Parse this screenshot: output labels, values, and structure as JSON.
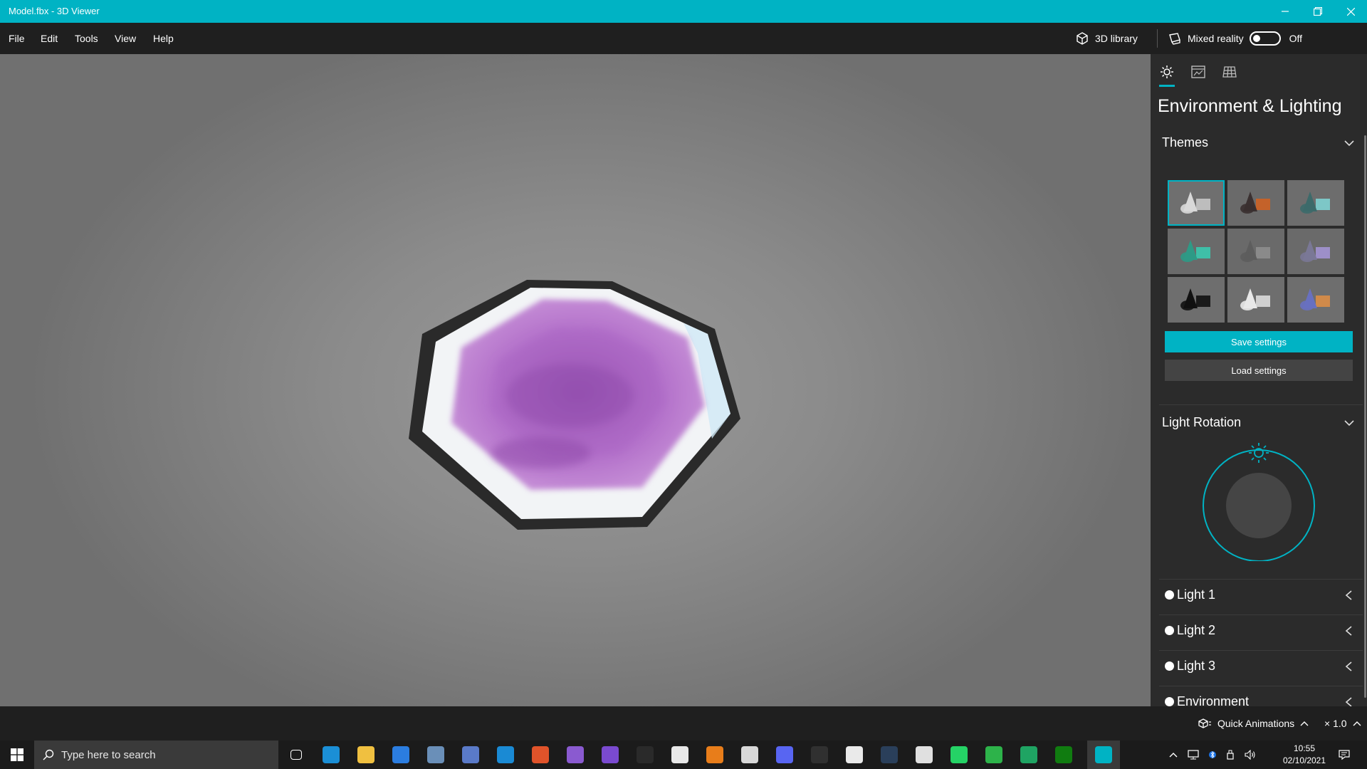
{
  "window": {
    "title": "Model.fbx - 3D Viewer"
  },
  "menu": {
    "items": [
      "File",
      "Edit",
      "Tools",
      "View",
      "Help"
    ],
    "library_label": "3D library",
    "mixed_reality_label": "Mixed reality",
    "mixed_reality_state": "Off"
  },
  "panel": {
    "title": "Environment & Lighting",
    "tabs": [
      "sun-icon",
      "stats-icon",
      "grid-icon"
    ],
    "themes": {
      "title": "Themes",
      "tiles": [
        {
          "name": "theme-1",
          "bg": "#6f6f6f",
          "shape": "#d8d8d8",
          "accent": "#bdbdbd"
        },
        {
          "name": "theme-2",
          "bg": "#6a6a6a",
          "shape": "#3a3030",
          "accent": "#c4622a"
        },
        {
          "name": "theme-3",
          "bg": "#6d6d6d",
          "shape": "#3c6a6a",
          "accent": "#7dc7c7"
        },
        {
          "name": "theme-4",
          "bg": "#6a6a6a",
          "shape": "#2e9a86",
          "accent": "#3fbfa8"
        },
        {
          "name": "theme-5",
          "bg": "#6a6a6a",
          "shape": "#5d5d5d",
          "accent": "#8a8a8a"
        },
        {
          "name": "theme-6",
          "bg": "#6a6a6a",
          "shape": "#7a7896",
          "accent": "#9d8fc8"
        },
        {
          "name": "theme-7",
          "bg": "#6e6e6e",
          "shape": "#111111",
          "accent": "#1a1a1a"
        },
        {
          "name": "theme-8",
          "bg": "#6e6e6e",
          "shape": "#e8e8e8",
          "accent": "#d0d0d0"
        },
        {
          "name": "theme-9",
          "bg": "#6e6e6e",
          "shape": "#6870c0",
          "accent": "#d08a4a"
        }
      ],
      "selected_index": 0
    },
    "save_label": "Save settings",
    "load_label": "Load settings",
    "light_rotation_title": "Light Rotation",
    "lights": [
      "Light 1",
      "Light 2",
      "Light 3",
      "Environment"
    ]
  },
  "status": {
    "quick_animations": "Quick Animations",
    "speed": "× 1.0"
  },
  "taskbar": {
    "search_placeholder": "Type here to search",
    "time": "10:55",
    "date": "02/10/2021",
    "apps": [
      {
        "name": "task-view-icon",
        "color": "#1b1b1b"
      },
      {
        "name": "edge-icon",
        "color": "#1b8fd6"
      },
      {
        "name": "file-explorer-icon",
        "color": "#f0c040"
      },
      {
        "name": "store-icon",
        "color": "#2b7de0"
      },
      {
        "name": "mail-icon",
        "color": "#6a8fb8"
      },
      {
        "name": "network-tool-icon",
        "color": "#5a7ac8"
      },
      {
        "name": "vs-code-icon",
        "color": "#1a8ad4"
      },
      {
        "name": "git-icon",
        "color": "#e0532a"
      },
      {
        "name": "visual-studio-icon",
        "color": "#8a5ad0"
      },
      {
        "name": "github-icon",
        "color": "#7a4ad0"
      },
      {
        "name": "terminal-icon",
        "color": "#2a2a2a"
      },
      {
        "name": "xd-icon",
        "color": "#e8e8e8"
      },
      {
        "name": "blender-icon",
        "color": "#e87d1a"
      },
      {
        "name": "files-icon",
        "color": "#d8d8d8"
      },
      {
        "name": "discord-icon",
        "color": "#5865f2"
      },
      {
        "name": "obs-icon",
        "color": "#303030"
      },
      {
        "name": "unity-hub-icon",
        "color": "#eaeaea"
      },
      {
        "name": "steam-icon",
        "color": "#2a3f5a"
      },
      {
        "name": "unity-icon",
        "color": "#e0e0e0"
      },
      {
        "name": "whatsapp-icon",
        "color": "#25d366"
      },
      {
        "name": "chat-icon",
        "color": "#2db34a"
      },
      {
        "name": "hangouts-icon",
        "color": "#1fa463"
      },
      {
        "name": "xbox-icon",
        "color": "#107c10"
      },
      {
        "name": "3d-viewer-icon",
        "color": "#00b3c4"
      }
    ]
  }
}
